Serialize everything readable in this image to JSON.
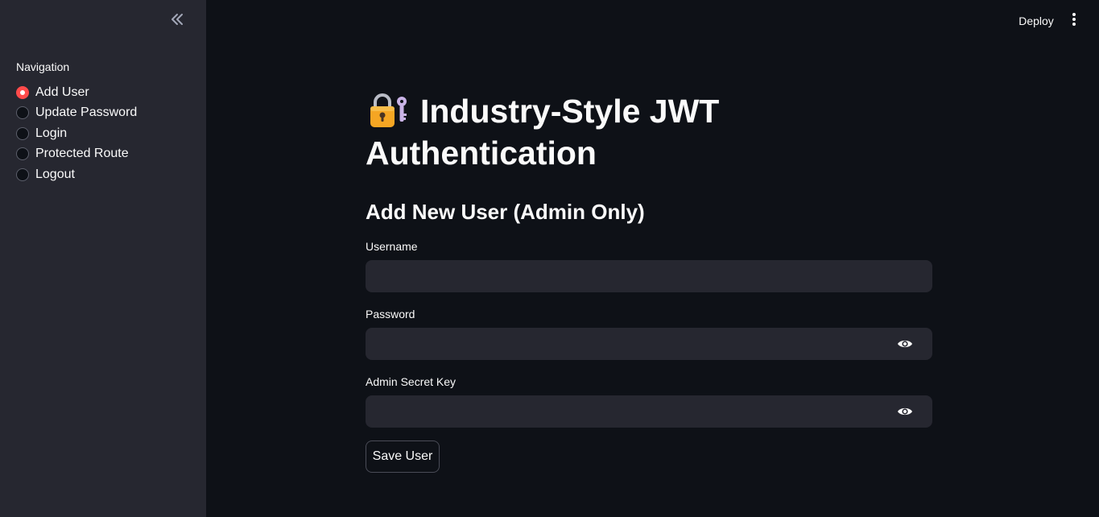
{
  "sidebar": {
    "collapse_icon": "double-chevron-left-icon",
    "nav_label": "Navigation",
    "items": [
      {
        "label": "Add User",
        "selected": true
      },
      {
        "label": "Update Password",
        "selected": false
      },
      {
        "label": "Login",
        "selected": false
      },
      {
        "label": "Protected Route",
        "selected": false
      },
      {
        "label": "Logout",
        "selected": false
      }
    ]
  },
  "topbar": {
    "deploy_label": "Deploy",
    "menu_icon": "vertical-dots-icon"
  },
  "main": {
    "title_icon": "lock-with-key-icon",
    "title": "Industry-Style JWT Authentication",
    "subtitle": "Add New User (Admin Only)",
    "fields": {
      "username": {
        "label": "Username",
        "value": ""
      },
      "password": {
        "label": "Password",
        "value": ""
      },
      "admin_key": {
        "label": "Admin Secret Key",
        "value": ""
      }
    },
    "save_label": "Save User"
  },
  "colors": {
    "background": "#0e1117",
    "sidebar": "#262730",
    "accent": "#ff4b4b",
    "input_bg": "#262730",
    "text": "#fafafa"
  }
}
